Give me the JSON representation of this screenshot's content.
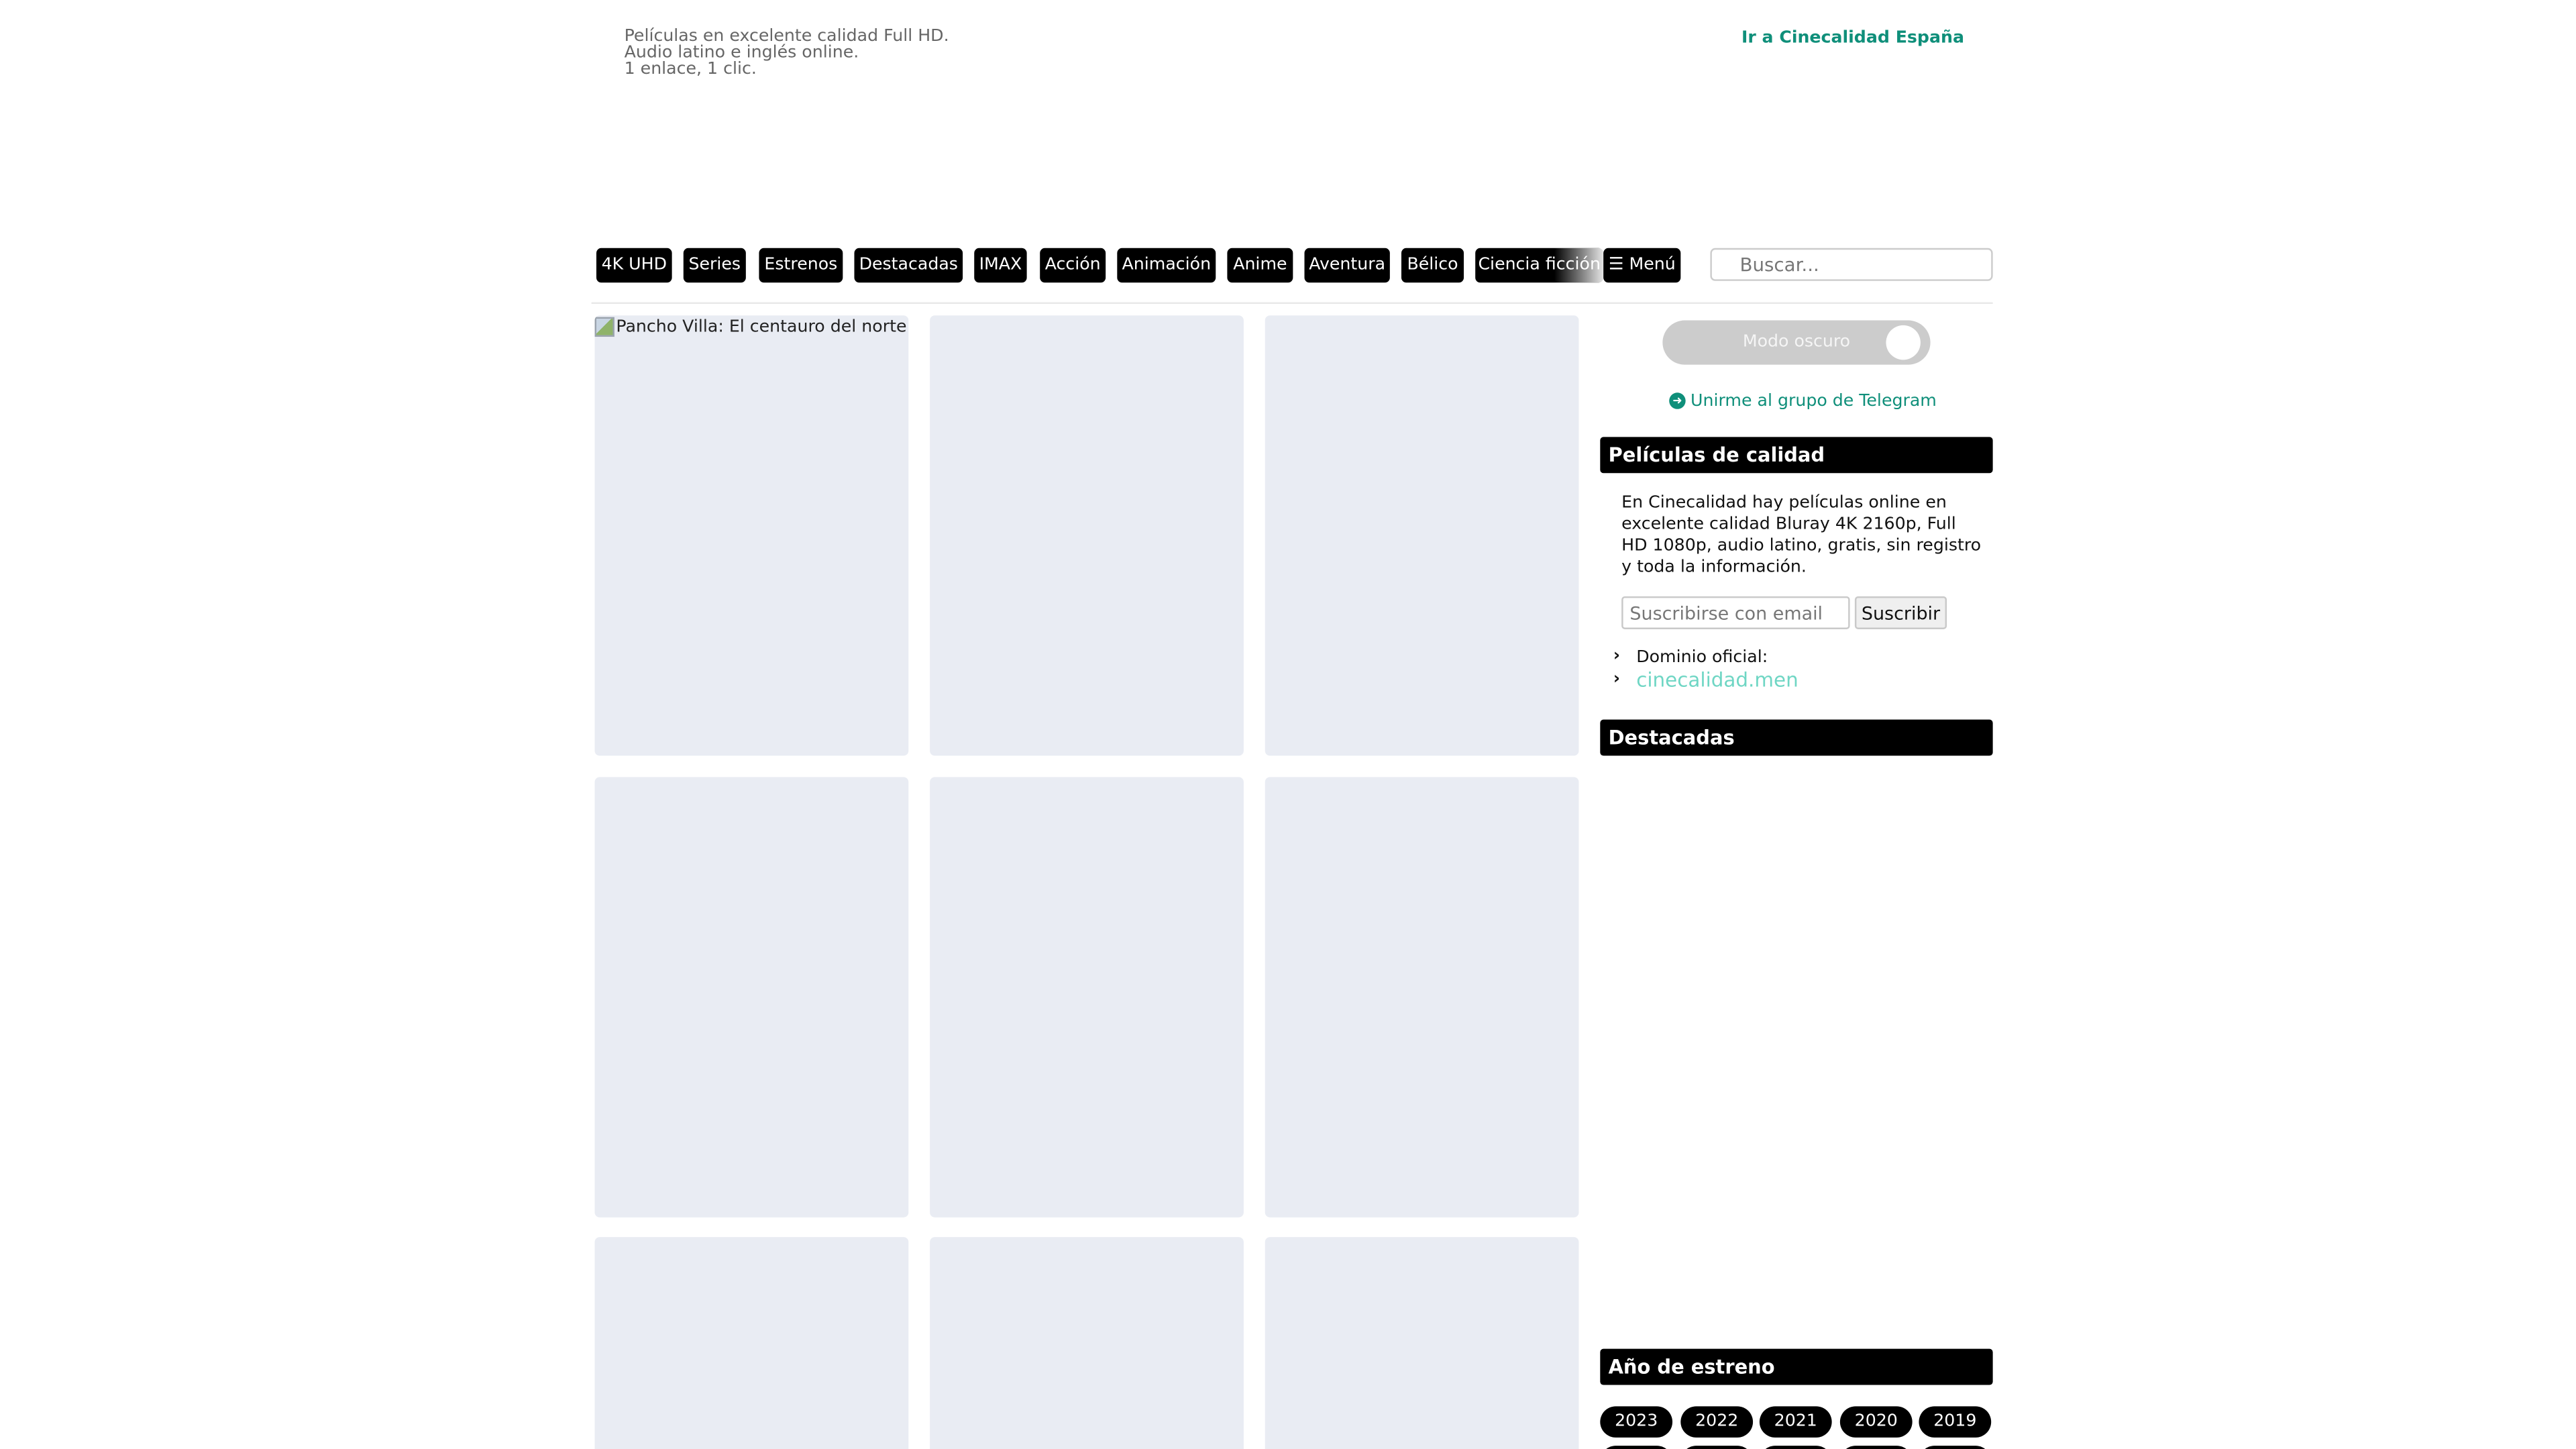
{
  "header": {
    "tagline": [
      "Películas en excelente calidad Full HD.",
      "Audio latino e inglés online.",
      "1 enlace, 1 clic."
    ],
    "spain_link": "Ir a Cinecalidad España"
  },
  "nav": {
    "items": [
      "4K UHD",
      "Series",
      "Estrenos",
      "Destacadas",
      "IMAX",
      "Acción",
      "Animación",
      "Anime",
      "Aventura",
      "Bélico",
      "Ciencia ficción"
    ],
    "menu_label": "☰ Menú"
  },
  "search": {
    "placeholder": "Buscar..."
  },
  "grid": {
    "first_card_alt": "Pancho Villa: El centauro del norte"
  },
  "sidebar": {
    "dark_mode_label": "Modo oscuro",
    "telegram_label": "Unirme al grupo de Telegram",
    "quality_title": "Películas de calidad",
    "quality_text": "En Cinecalidad hay películas online en excelente calidad Bluray 4K 2160p, Full HD 1080p, audio latino, gratis, sin registro y toda la información.",
    "subscribe_placeholder": "Suscribirse con email",
    "subscribe_button": "Suscribir",
    "domain_label": "Dominio oficial:",
    "domain_link": "cinecalidad.men",
    "featured_title": "Destacadas",
    "years_title": "Año de estreno",
    "years": [
      "2023",
      "2022",
      "2021",
      "2020",
      "2019"
    ]
  },
  "colors": {
    "accent": "#0f8f7a",
    "link_light": "#6fd6c4",
    "placeholder_card": "#e9ecf3"
  }
}
